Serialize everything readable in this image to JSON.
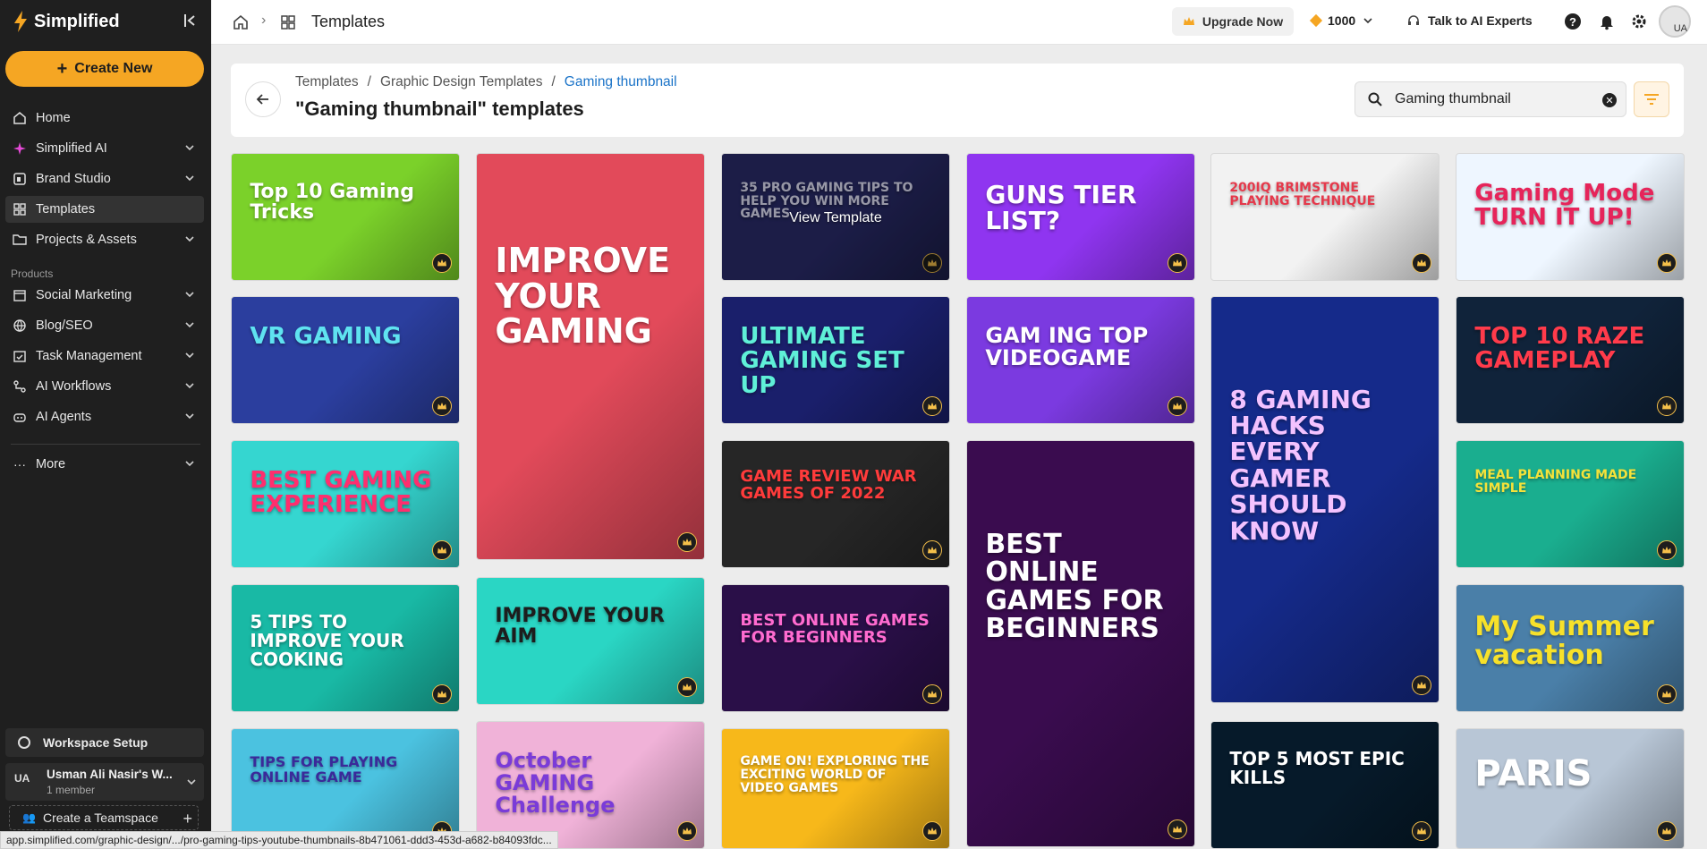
{
  "app": {
    "name": "Simplified"
  },
  "sidebar": {
    "create_label": "Create New",
    "items": [
      {
        "label": "Home",
        "icon": "home-icon"
      },
      {
        "label": "Simplified AI",
        "icon": "sparkle-icon"
      },
      {
        "label": "Brand Studio",
        "icon": "brand-icon"
      },
      {
        "label": "Templates",
        "icon": "grid-icon"
      },
      {
        "label": "Projects & Assets",
        "icon": "folder-icon"
      }
    ],
    "products_label": "Products",
    "products": [
      {
        "label": "Social Marketing",
        "icon": "calendar-icon"
      },
      {
        "label": "Blog/SEO",
        "icon": "globe-icon"
      },
      {
        "label": "Task Management",
        "icon": "tasks-icon"
      },
      {
        "label": "AI Workflows",
        "icon": "workflow-icon"
      },
      {
        "label": "AI Agents",
        "icon": "robot-icon"
      }
    ],
    "more_label": "More",
    "workspace_setup": "Workspace Setup",
    "user": {
      "initials": "UA",
      "name": "Usman Ali Nasir's W...",
      "members": "1 member"
    },
    "create_teamspace": "Create a Teamspace"
  },
  "topbar": {
    "title": "Templates",
    "upgrade": "Upgrade Now",
    "credits": "1000",
    "talk": "Talk to AI Experts",
    "avatar": "UA"
  },
  "header": {
    "breadcrumbs": [
      "Templates",
      "/",
      "Graphic Design Templates",
      "/",
      "Gaming thumbnail"
    ],
    "title": "\"Gaming thumbnail\" templates",
    "search_value": "Gaming thumbnail"
  },
  "tiles": [
    {
      "text": "Top 10 Gaming Tricks",
      "bg": "#7bd12a",
      "fg": "#fff"
    },
    {
      "text": "VR GAMING",
      "bg": "#2b3e9e",
      "fg": "#5fe3f0"
    },
    {
      "text": "BEST GAMING EXPERIENCE",
      "bg": "#35d6d0",
      "fg": "#ff2e6e"
    },
    {
      "text": "5 TIPS TO IMPROVE YOUR COOKING",
      "bg": "#19b9a5",
      "fg": "#fff"
    },
    {
      "text": "TIPS FOR PLAYING ONLINE GAME",
      "bg": "#4bc2e0",
      "fg": "#3a2a9a"
    },
    {
      "text": "IMPROVE YOUR GAMING",
      "bg": "#e24a5a",
      "fg": "#fff"
    },
    {
      "text": "IMPROVE YOUR AIM",
      "bg": "#2ad6c4",
      "fg": "#1d1d1d"
    },
    {
      "text": "October GAMING Challenge",
      "bg": "#f0b2d8",
      "fg": "#7a3bd8"
    },
    {
      "text": "35 PRO GAMING TIPS TO HELP YOU WIN MORE GAMES",
      "bg": "#2b2d6e",
      "fg": "#e9e9ff",
      "view": "View Template"
    },
    {
      "text": "ULTIMATE GAMING SET UP",
      "bg": "#1a1f6b",
      "fg": "#5ff0d8"
    },
    {
      "text": "GAME REVIEW WAR GAMES OF 2022",
      "bg": "#262626",
      "fg": "#ff3b3b"
    },
    {
      "text": "BEST ONLINE GAMES FOR BEGINNERS",
      "bg": "#2a0f48",
      "fg": "#ff6bd0"
    },
    {
      "text": "GAME ON! EXPLORING THE EXCITING WORLD OF VIDEO GAMES",
      "bg": "#f7b81a",
      "fg": "#fff"
    },
    {
      "text": "GUNS TIER LIST?",
      "bg": "#8f35f0",
      "fg": "#fff"
    },
    {
      "text": "GAM ING TOP VIDEOGAME",
      "bg": "#7b3ae0",
      "fg": "#fff"
    },
    {
      "text": "BEST ONLINE GAMES FOR BEGINNERS",
      "bg": "#3a0c4f",
      "fg": "#fff"
    },
    {
      "text": "200IQ BRIMSTONE PLAYING TECHNIQUE",
      "bg": "#f2f2f2",
      "fg": "#e5394b"
    },
    {
      "text": "8 GAMING HACKS EVERY GAMER SHOULD KNOW",
      "bg": "#152a8a",
      "fg": "#f3c2ff"
    },
    {
      "text": "TOP 5 MOST EPIC KILLS",
      "bg": "#061a2a",
      "fg": "#fff"
    },
    {
      "text": "Gaming Mode TURN IT UP!",
      "bg": "#eef6ff",
      "fg": "#e6245a"
    },
    {
      "text": "TOP 10 RAZE GAMEPLAY",
      "bg": "#10233a",
      "fg": "#ff3b4b"
    },
    {
      "text": "MEAL PLANNING MADE SIMPLE",
      "bg": "#1aae8f",
      "fg": "#f4e23a"
    },
    {
      "text": "My Summer vacation",
      "bg": "#4a7fa8",
      "fg": "#f7e12a"
    },
    {
      "text": "PARIS",
      "bg": "#b8c6d6",
      "fg": "#fff"
    }
  ],
  "statusbar": "app.simplified.com/graphic-design/.../pro-gaming-tips-youtube-thumbnails-8b471061-ddd3-453d-a682-b84093fdc..."
}
